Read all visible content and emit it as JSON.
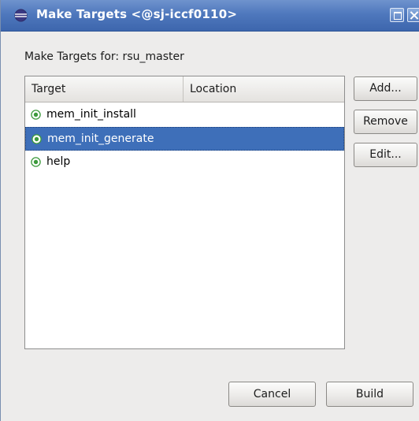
{
  "window": {
    "title": "Make Targets  <@sj-iccf0110>"
  },
  "dialog": {
    "label": "Make Targets for: rsu_master"
  },
  "table": {
    "columns": [
      "Target",
      "Location"
    ],
    "rows": [
      {
        "target": "mem_init_install",
        "location": "",
        "selected": false
      },
      {
        "target": "mem_init_generate",
        "location": "",
        "selected": true
      },
      {
        "target": "help",
        "location": "",
        "selected": false
      }
    ]
  },
  "buttons": {
    "add": "Add...",
    "remove": "Remove",
    "edit": "Edit...",
    "cancel": "Cancel",
    "build": "Build"
  },
  "icons": {
    "title": "eclipse-icon",
    "row": "target-icon",
    "maximize": "maximize-icon",
    "close": "close-icon"
  },
  "colors": {
    "titlebar": "#4f78bd",
    "selection": "#3e6fb9",
    "target_icon": "#3c9a3c",
    "background": "#edeceb"
  }
}
